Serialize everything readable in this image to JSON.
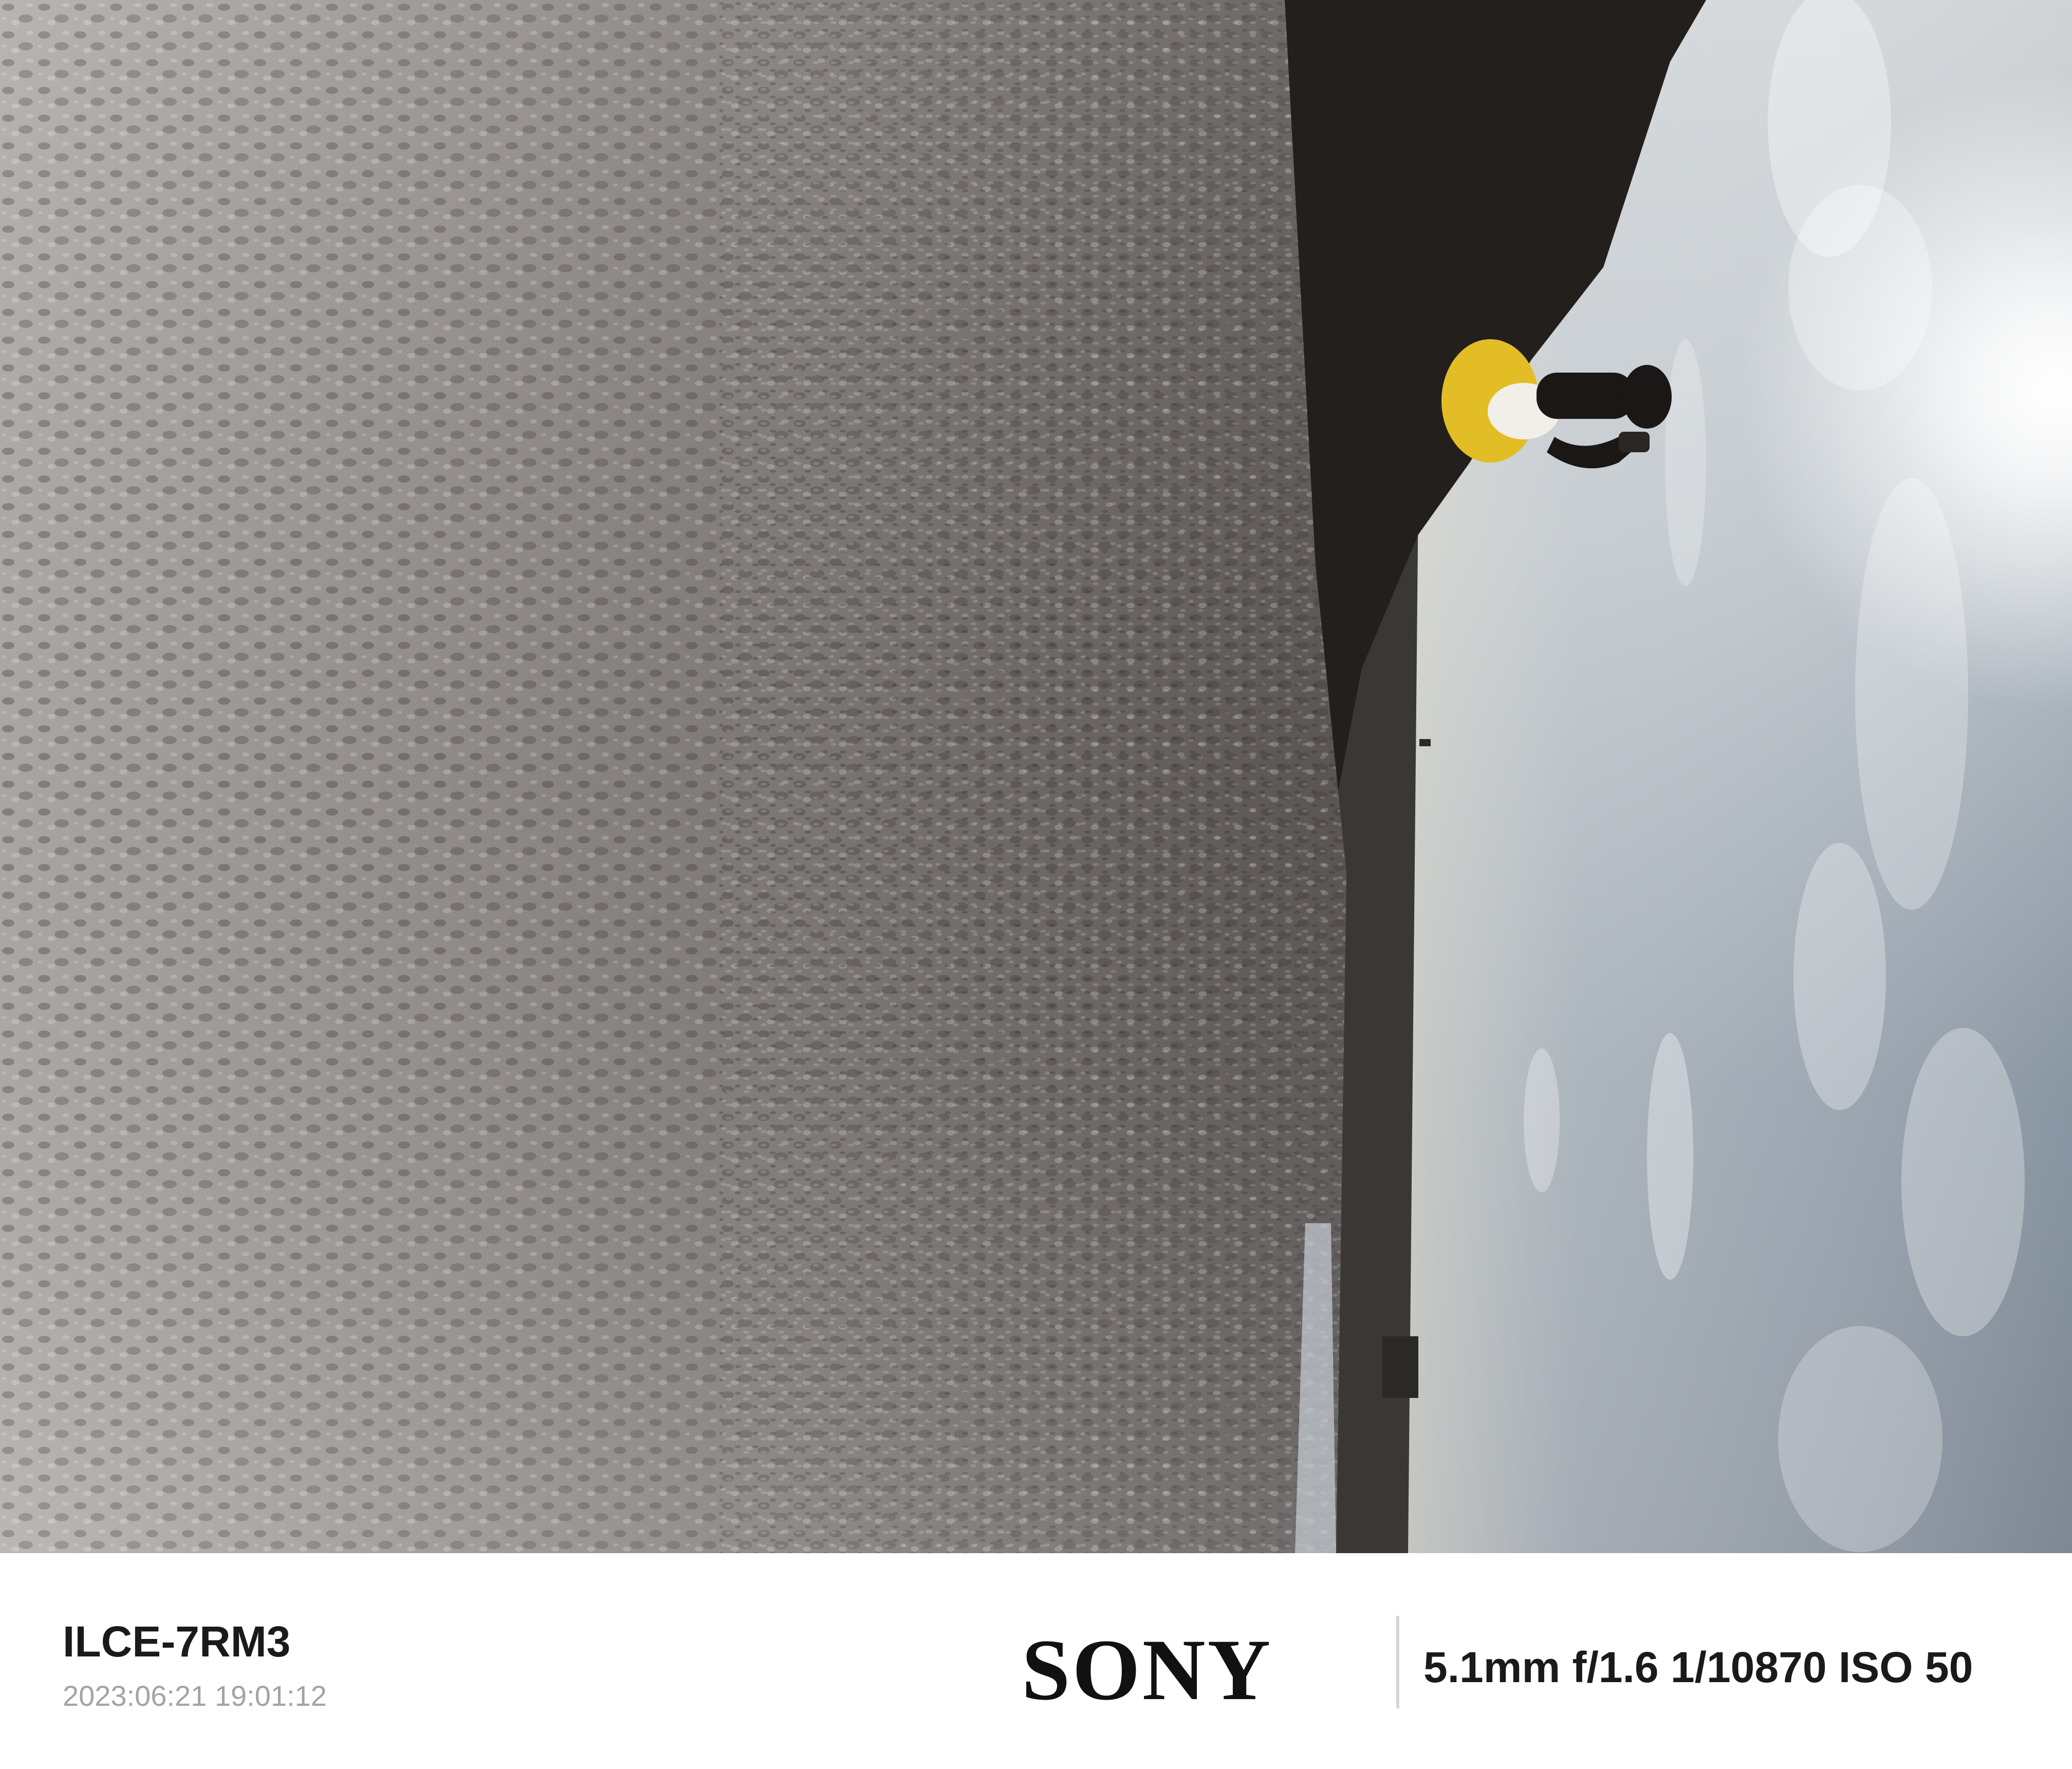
{
  "photo": {
    "orientation": "rotated-90-counterclockwise",
    "colors": {
      "salt_light": "#a8a4a3",
      "salt_dark": "#55504f",
      "sky_light": "#d9dcde",
      "sky_dark": "#707b88",
      "ridge": "#221f1d",
      "jacket": "#e3bd25"
    }
  },
  "info_bar": {
    "camera_model": "ILCE-7RM3",
    "capture_time": "2023:06:21 19:01:12",
    "brand": "SONY",
    "exif": "5.1mm f/1.6 1/10870 ISO 50"
  }
}
